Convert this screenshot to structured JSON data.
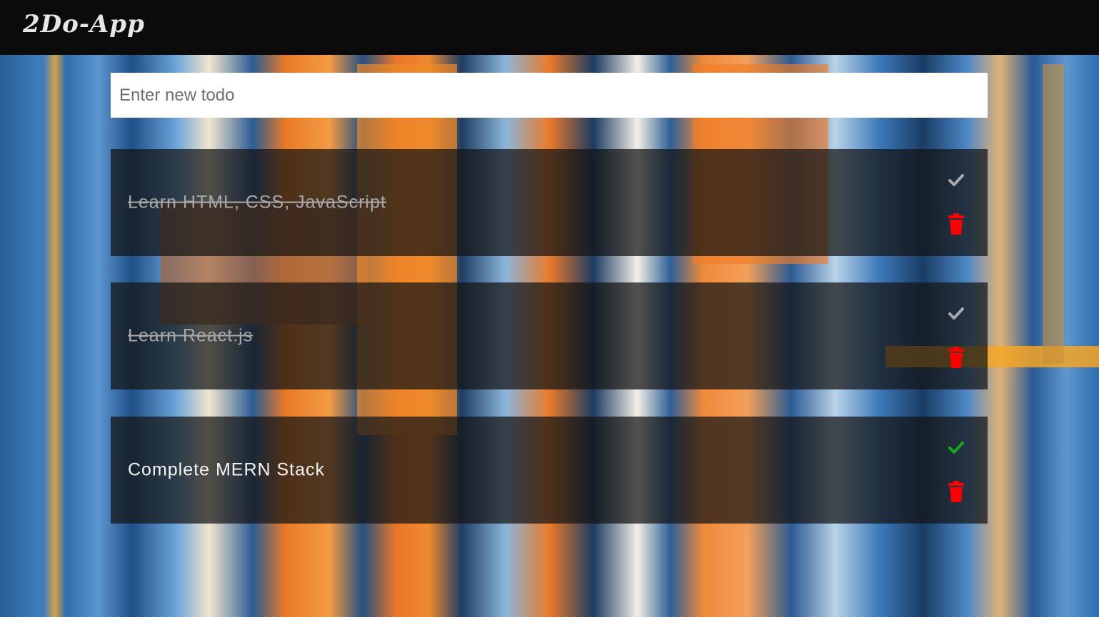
{
  "app": {
    "logo": "2Do-App"
  },
  "new_todo": {
    "placeholder": "Enter new todo"
  },
  "todos": [
    {
      "text": "Learn HTML, CSS, JavaScript",
      "completed": true,
      "check_icon": "check-icon",
      "delete_icon": "trash-icon"
    },
    {
      "text": "Learn React.js",
      "completed": true,
      "check_icon": "check-icon",
      "delete_icon": "trash-icon"
    },
    {
      "text": "Complete MERN Stack",
      "completed": false,
      "check_icon": "check-icon",
      "delete_icon": "trash-icon"
    }
  ],
  "colors": {
    "header_bg": "#0b0b0b",
    "logo_text": "#e6e6e6",
    "card_bg": "rgba(20,20,20,0.72)",
    "completed_text": "#a8a8a8",
    "active_text": "#f3f3f3",
    "check_completed": "#a9a9a9",
    "check_active": "#14a814",
    "delete": "#ff0000"
  }
}
